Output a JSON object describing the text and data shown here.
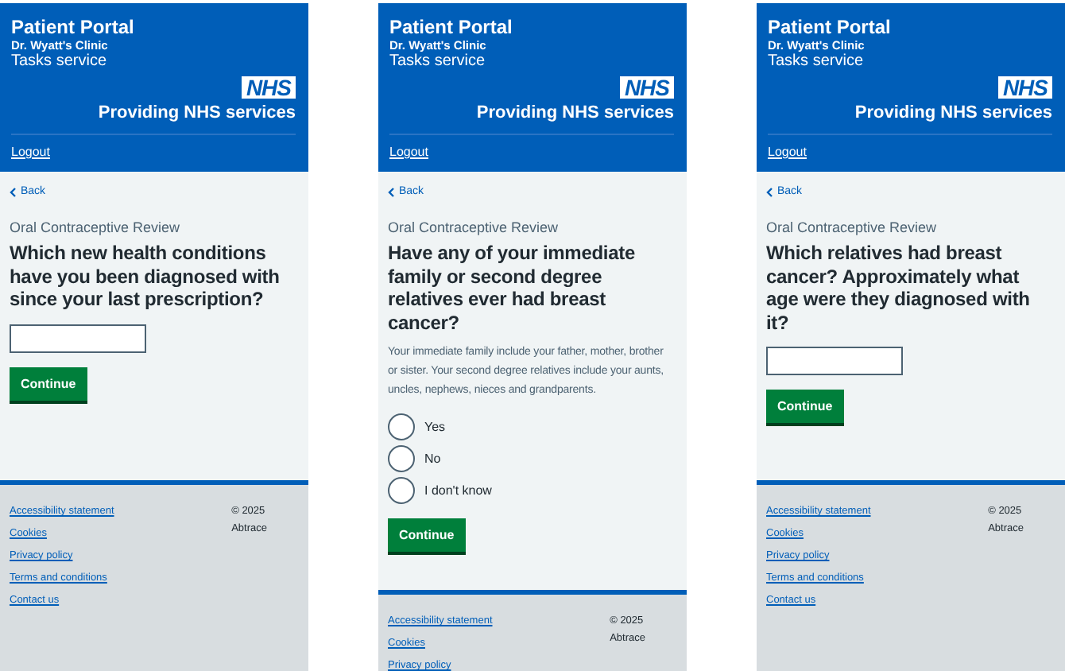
{
  "screens": [
    {
      "header": {
        "title": "Patient Portal",
        "clinic": "Dr. Wyatt's Clinic",
        "service": "Tasks service",
        "logo": "NHS",
        "tagline": "Providing NHS services",
        "logout": "Logout"
      },
      "back": "Back",
      "caption": "Oral Contraceptive Review",
      "question": "Which new health conditions have you been diagnosed with since your last prescription?",
      "kind": "text",
      "button": "Continue",
      "footer": {
        "links": [
          "Accessibility statement",
          "Cookies",
          "Privacy policy",
          "Terms and conditions",
          "Contact us"
        ],
        "copyright": "© 2025",
        "company": "Abtrace"
      }
    },
    {
      "header": {
        "title": "Patient Portal",
        "clinic": "Dr. Wyatt's Clinic",
        "service": "Tasks service",
        "logo": "NHS",
        "tagline": "Providing NHS services",
        "logout": "Logout"
      },
      "back": "Back",
      "caption": "Oral Contraceptive Review",
      "question": "Have any of your immediate family or second degree relatives ever had breast cancer?",
      "hint": "Your immediate family include your father, mother, brother or sister. Your second degree relatives include your aunts, uncles, nephews, nieces and grandparents.",
      "kind": "radio",
      "options": [
        {
          "label": "Yes",
          "selected": false
        },
        {
          "label": "No",
          "selected": false
        },
        {
          "label": "I don't know",
          "selected": false
        }
      ],
      "button": "Continue",
      "footer": {
        "links": [
          "Accessibility statement",
          "Cookies",
          "Privacy policy"
        ],
        "copyright": "© 2025",
        "company": "Abtrace"
      }
    },
    {
      "header": {
        "title": "Patient Portal",
        "clinic": "Dr. Wyatt's Clinic",
        "service": "Tasks service",
        "logo": "NHS",
        "tagline": "Providing NHS services",
        "logout": "Logout"
      },
      "back": "Back",
      "caption": "Oral Contraceptive Review",
      "question": "Which relatives had breast cancer? Approximately what age were they diagnosed with it?",
      "kind": "text",
      "button": "Continue",
      "footer": {
        "links": [
          "Accessibility statement",
          "Cookies",
          "Privacy policy",
          "Terms and conditions",
          "Contact us"
        ],
        "copyright": "© 2025",
        "company": "Abtrace"
      }
    }
  ]
}
